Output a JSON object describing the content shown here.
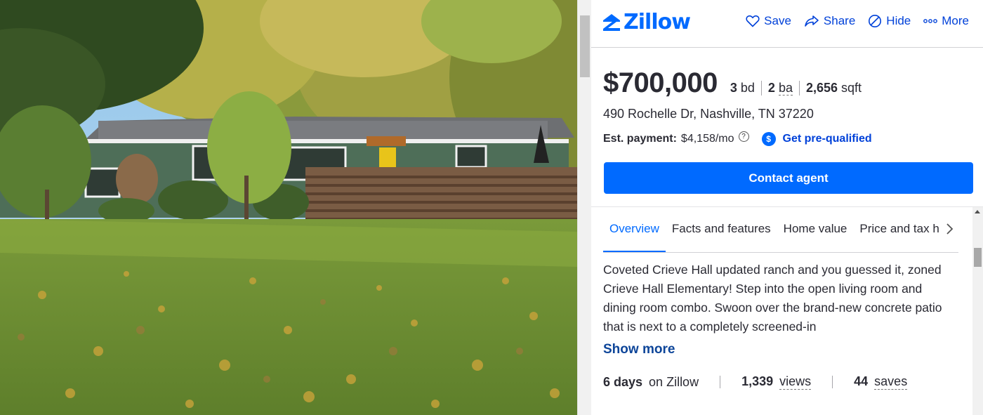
{
  "photo": {
    "icon": "house-photo"
  },
  "header": {
    "logo_text": "Zillow",
    "actions": [
      {
        "label": "Save",
        "icon": "heart-icon"
      },
      {
        "label": "Share",
        "icon": "share-icon"
      },
      {
        "label": "Hide",
        "icon": "hide-icon"
      },
      {
        "label": "More",
        "icon": "more-icon"
      }
    ]
  },
  "listing": {
    "price": "$700,000",
    "beds_value": "3",
    "beds_unit": "bd",
    "baths_value": "2",
    "baths_unit": "ba",
    "sqft_value": "2,656",
    "sqft_unit": "sqft",
    "address": "490 Rochelle Dr, Nashville, TN 37220",
    "payment_label": "Est. payment:",
    "payment_value": "$4,158/mo",
    "help_glyph": "?",
    "prequal_glyph": "$",
    "prequal_label": "Get pre-qualified",
    "contact_label": "Contact agent"
  },
  "tabs": [
    {
      "label": "Overview",
      "active": true
    },
    {
      "label": "Facts and features",
      "active": false
    },
    {
      "label": "Home value",
      "active": false
    },
    {
      "label": "Price and tax h",
      "active": false
    }
  ],
  "description": "Coveted Crieve Hall updated ranch and you guessed it, zoned Crieve Hall Elementary!  Step into the open living room and dining room combo. Swoon over the brand-new concrete patio that is next to a completely screened-in",
  "show_more": "Show more",
  "stats": {
    "days_value": "6 days",
    "days_label": "on Zillow",
    "views_value": "1,339",
    "views_label": "views",
    "saves_value": "44",
    "saves_label": "saves"
  },
  "colors": {
    "brand": "#006aff",
    "link": "#0041d9",
    "text": "#2a2a33"
  }
}
